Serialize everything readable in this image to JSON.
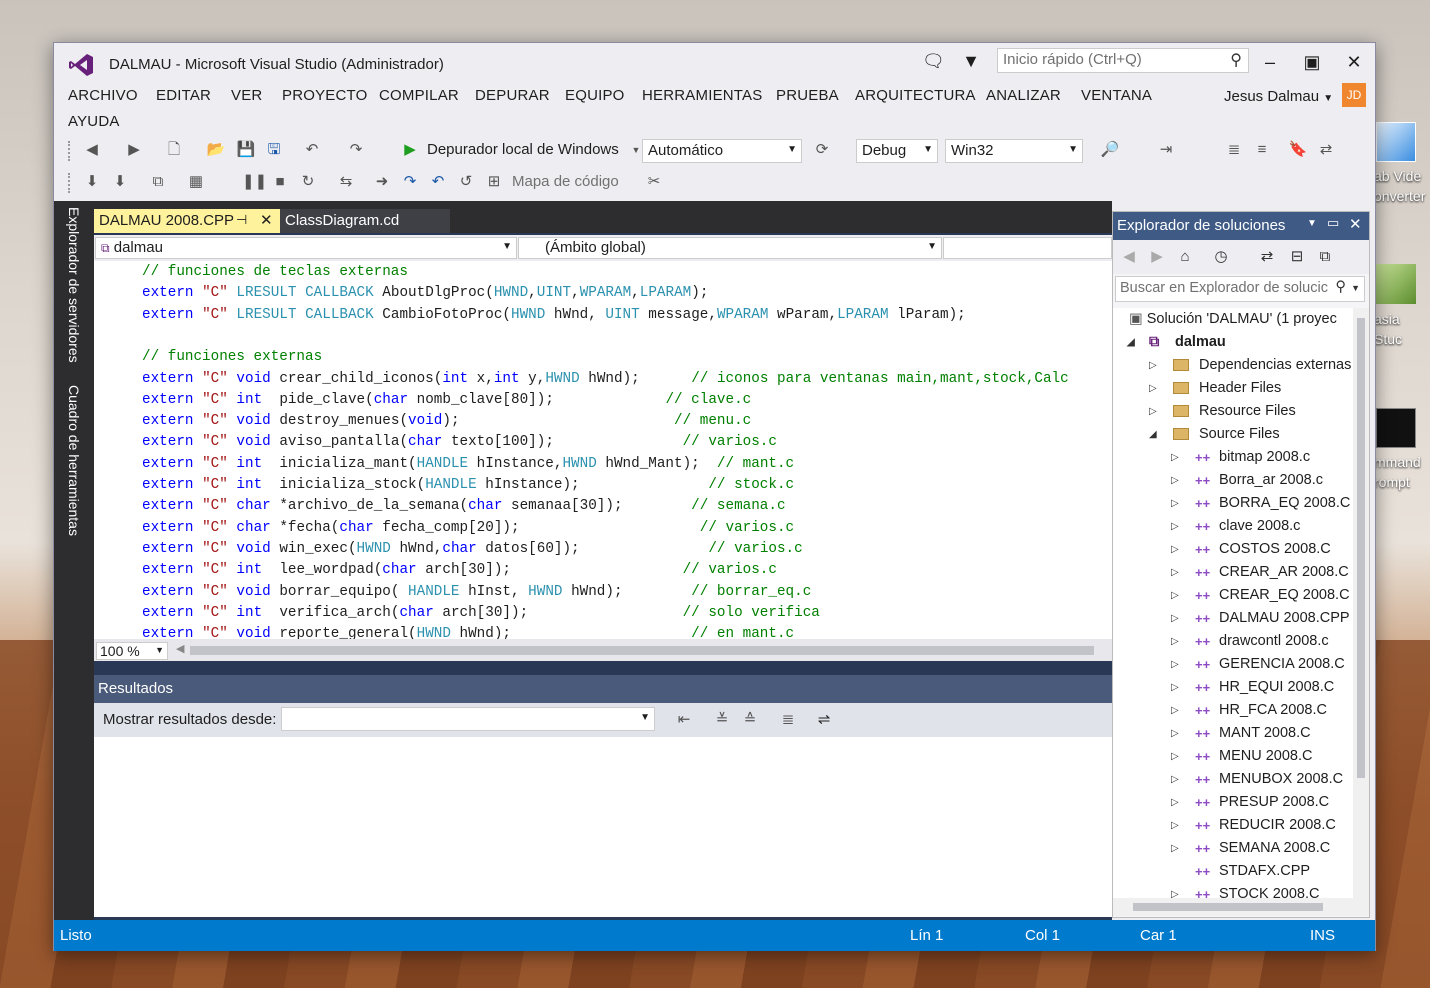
{
  "desktop": {
    "icons": [
      {
        "label": "ab Vide\nonverter"
      },
      {
        "label": "asia Stuc"
      },
      {
        "label": "mmand\nrompt"
      }
    ]
  },
  "window": {
    "title": "DALMAU - Microsoft Visual Studio (Administrador)"
  },
  "quick_launch": {
    "placeholder": "Inicio rápido (Ctrl+Q)"
  },
  "menus": [
    "ARCHIVO",
    "EDITAR",
    "VER",
    "PROYECTO",
    "COMPILAR",
    "DEPURAR",
    "EQUIPO",
    "HERRAMIENTAS",
    "PRUEBA",
    "ARQUITECTURA",
    "ANALIZAR",
    "VENTANA",
    "AYUDA"
  ],
  "user": {
    "name": "Jesus Dalmau",
    "initials": "JD"
  },
  "toolbar": {
    "debugger_label": "Depurador local de Windows",
    "solution_config": "Automático",
    "build_config": "Debug",
    "platform": "Win32",
    "code_map": "Mapa de código"
  },
  "side_tabs": {
    "server_explorer": "Explorador de servidores",
    "toolbox": "Cuadro de herramientas"
  },
  "doc_tabs": [
    {
      "label": "DALMAU 2008.CPP"
    },
    {
      "label": "ClassDiagram.cd"
    }
  ],
  "nav": {
    "project": "dalmau",
    "scope": "(Ámbito global)"
  },
  "code_lines": [
    [
      [
        "cm",
        "// funciones de teclas externas"
      ]
    ],
    [
      [
        "kw",
        "extern"
      ],
      [
        "t",
        " "
      ],
      [
        "str",
        "\"C\""
      ],
      [
        "t",
        " "
      ],
      [
        "ty",
        "LRESULT"
      ],
      [
        "t",
        " "
      ],
      [
        "ty",
        "CALLBACK"
      ],
      [
        "t",
        " AboutDlgProc("
      ],
      [
        "ty",
        "HWND"
      ],
      [
        "t",
        ","
      ],
      [
        "ty",
        "UINT"
      ],
      [
        "t",
        ","
      ],
      [
        "ty",
        "WPARAM"
      ],
      [
        "t",
        ","
      ],
      [
        "ty",
        "LPARAM"
      ],
      [
        "t",
        ");"
      ]
    ],
    [
      [
        "kw",
        "extern"
      ],
      [
        "t",
        " "
      ],
      [
        "str",
        "\"C\""
      ],
      [
        "t",
        " "
      ],
      [
        "ty",
        "LRESULT"
      ],
      [
        "t",
        " "
      ],
      [
        "ty",
        "CALLBACK"
      ],
      [
        "t",
        " CambioFotoProc("
      ],
      [
        "ty",
        "HWND"
      ],
      [
        "t",
        " hWnd, "
      ],
      [
        "ty",
        "UINT"
      ],
      [
        "t",
        " message,"
      ],
      [
        "ty",
        "WPARAM"
      ],
      [
        "t",
        " wParam,"
      ],
      [
        "ty",
        "LPARAM"
      ],
      [
        "t",
        " lParam);"
      ]
    ],
    [],
    [
      [
        "cm",
        "// funciones externas"
      ]
    ],
    [
      [
        "kw",
        "extern"
      ],
      [
        "t",
        " "
      ],
      [
        "str",
        "\"C\""
      ],
      [
        "t",
        " "
      ],
      [
        "kw",
        "void"
      ],
      [
        "t",
        " crear_child_iconos("
      ],
      [
        "kw",
        "int"
      ],
      [
        "t",
        " x,"
      ],
      [
        "kw",
        "int"
      ],
      [
        "t",
        " y,"
      ],
      [
        "ty",
        "HWND"
      ],
      [
        "t",
        " hWnd);      "
      ],
      [
        "cm",
        "// iconos para ventanas main,mant,stock,Calc"
      ]
    ],
    [
      [
        "kw",
        "extern"
      ],
      [
        "t",
        " "
      ],
      [
        "str",
        "\"C\""
      ],
      [
        "t",
        " "
      ],
      [
        "kw",
        "int"
      ],
      [
        "t",
        "  pide_clave("
      ],
      [
        "kw",
        "char"
      ],
      [
        "t",
        " nomb_clave[80]);             "
      ],
      [
        "cm",
        "// clave.c"
      ]
    ],
    [
      [
        "kw",
        "extern"
      ],
      [
        "t",
        " "
      ],
      [
        "str",
        "\"C\""
      ],
      [
        "t",
        " "
      ],
      [
        "kw",
        "void"
      ],
      [
        "t",
        " destroy_menues("
      ],
      [
        "kw",
        "void"
      ],
      [
        "t",
        ");                         "
      ],
      [
        "cm",
        "// menu.c"
      ]
    ],
    [
      [
        "kw",
        "extern"
      ],
      [
        "t",
        " "
      ],
      [
        "str",
        "\"C\""
      ],
      [
        "t",
        " "
      ],
      [
        "kw",
        "void"
      ],
      [
        "t",
        " aviso_pantalla("
      ],
      [
        "kw",
        "char"
      ],
      [
        "t",
        " texto[100]);               "
      ],
      [
        "cm",
        "// varios.c"
      ]
    ],
    [
      [
        "kw",
        "extern"
      ],
      [
        "t",
        " "
      ],
      [
        "str",
        "\"C\""
      ],
      [
        "t",
        " "
      ],
      [
        "kw",
        "int"
      ],
      [
        "t",
        "  inicializa_mant("
      ],
      [
        "ty",
        "HANDLE"
      ],
      [
        "t",
        " hInstance,"
      ],
      [
        "ty",
        "HWND"
      ],
      [
        "t",
        " hWnd_Mant);  "
      ],
      [
        "cm",
        "// mant.c"
      ]
    ],
    [
      [
        "kw",
        "extern"
      ],
      [
        "t",
        " "
      ],
      [
        "str",
        "\"C\""
      ],
      [
        "t",
        " "
      ],
      [
        "kw",
        "int"
      ],
      [
        "t",
        "  inicializa_stock("
      ],
      [
        "ty",
        "HANDLE"
      ],
      [
        "t",
        " hInstance);               "
      ],
      [
        "cm",
        "// stock.c"
      ]
    ],
    [
      [
        "kw",
        "extern"
      ],
      [
        "t",
        " "
      ],
      [
        "str",
        "\"C\""
      ],
      [
        "t",
        " "
      ],
      [
        "kw",
        "char"
      ],
      [
        "t",
        " *archivo_de_la_semana("
      ],
      [
        "kw",
        "char"
      ],
      [
        "t",
        " semanaa[30]);        "
      ],
      [
        "cm",
        "// semana.c"
      ]
    ],
    [
      [
        "kw",
        "extern"
      ],
      [
        "t",
        " "
      ],
      [
        "str",
        "\"C\""
      ],
      [
        "t",
        " "
      ],
      [
        "kw",
        "char"
      ],
      [
        "t",
        " *fecha("
      ],
      [
        "kw",
        "char"
      ],
      [
        "t",
        " fecha_comp[20]);                     "
      ],
      [
        "cm",
        "// varios.c"
      ]
    ],
    [
      [
        "kw",
        "extern"
      ],
      [
        "t",
        " "
      ],
      [
        "str",
        "\"C\""
      ],
      [
        "t",
        " "
      ],
      [
        "kw",
        "void"
      ],
      [
        "t",
        " win_exec("
      ],
      [
        "ty",
        "HWND"
      ],
      [
        "t",
        " hWnd,"
      ],
      [
        "kw",
        "char"
      ],
      [
        "t",
        " datos[60]);               "
      ],
      [
        "cm",
        "// varios.c"
      ]
    ],
    [
      [
        "kw",
        "extern"
      ],
      [
        "t",
        " "
      ],
      [
        "str",
        "\"C\""
      ],
      [
        "t",
        " "
      ],
      [
        "kw",
        "int"
      ],
      [
        "t",
        "  lee_wordpad("
      ],
      [
        "kw",
        "char"
      ],
      [
        "t",
        " arch[30]);                    "
      ],
      [
        "cm",
        "// varios.c"
      ]
    ],
    [
      [
        "kw",
        "extern"
      ],
      [
        "t",
        " "
      ],
      [
        "str",
        "\"C\""
      ],
      [
        "t",
        " "
      ],
      [
        "kw",
        "void"
      ],
      [
        "t",
        " borrar_equipo( "
      ],
      [
        "ty",
        "HANDLE"
      ],
      [
        "t",
        " hInst, "
      ],
      [
        "ty",
        "HWND"
      ],
      [
        "t",
        " hWnd);        "
      ],
      [
        "cm",
        "// borrar_eq.c"
      ]
    ],
    [
      [
        "kw",
        "extern"
      ],
      [
        "t",
        " "
      ],
      [
        "str",
        "\"C\""
      ],
      [
        "t",
        " "
      ],
      [
        "kw",
        "int"
      ],
      [
        "t",
        "  verifica_arch("
      ],
      [
        "kw",
        "char"
      ],
      [
        "t",
        " arch[30]);                  "
      ],
      [
        "cm",
        "// solo verifica"
      ]
    ],
    [
      [
        "kw",
        "extern"
      ],
      [
        "t",
        " "
      ],
      [
        "str",
        "\"C\""
      ],
      [
        "t",
        " "
      ],
      [
        "kw",
        "void"
      ],
      [
        "t",
        " reporte_general("
      ],
      [
        "ty",
        "HWND"
      ],
      [
        "t",
        " hWnd);                     "
      ],
      [
        "cm",
        "// en mant.c"
      ]
    ]
  ],
  "zoom": "100 %",
  "results": {
    "title": "Resultados",
    "show_from_label": "Mostrar resultados desde:"
  },
  "solution_explorer": {
    "title": "Explorador de soluciones",
    "search_placeholder": "Buscar en Explorador de solucic",
    "solution": "Solución 'DALMAU'  (1 proyec",
    "project": "dalmau",
    "folders": [
      "Dependencias externas",
      "Header Files",
      "Resource Files",
      "Source Files"
    ],
    "files": [
      "bitmap 2008.c",
      "Borra_ar 2008.c",
      "BORRA_EQ 2008.C",
      "clave 2008.c",
      "COSTOS 2008.C",
      "CREAR_AR 2008.C",
      "CREAR_EQ 2008.C",
      "DALMAU 2008.CPP",
      "drawcontl 2008.c",
      "GERENCIA 2008.C",
      "HR_EQUI 2008.C",
      "HR_FCA 2008.C",
      "MANT 2008.C",
      "MENU 2008.C",
      "MENUBOX 2008.C",
      "PRESUP 2008.C",
      "REDUCIR 2008.C",
      "SEMANA 2008.C",
      "STDAFX.CPP",
      "STOCK 2008.C"
    ]
  },
  "status": {
    "ready": "Listo",
    "line": "Lín 1",
    "col": "Col 1",
    "char": "Car 1",
    "mode": "INS"
  },
  "colors": {
    "accent": "#007acc",
    "active_tab": "#fff29d",
    "keyword": "#0000ff",
    "comment": "#008000",
    "string": "#a31515",
    "type": "#2b91af"
  }
}
